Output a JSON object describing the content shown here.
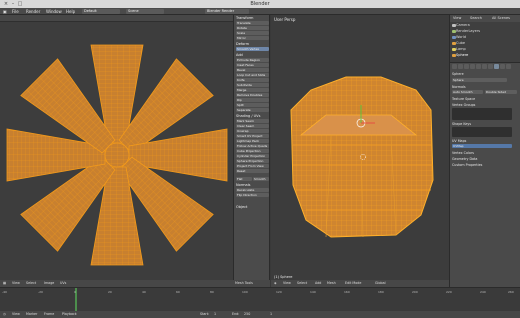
{
  "window": {
    "title": "Blender"
  },
  "menubar": {
    "items": [
      "File",
      "Render",
      "Window",
      "Help"
    ],
    "layout": "Default",
    "scene": "Scene",
    "engine": "Blender Render"
  },
  "uv_editor": {
    "header_items": [
      "View",
      "Select",
      "Image",
      "UVs"
    ],
    "footer_items": [
      "View",
      "Select",
      "Image",
      "UVs"
    ]
  },
  "tool_shelf": {
    "sections": [
      "Transform",
      "Deform",
      "Add",
      "Shading / UVs",
      "Object"
    ],
    "buttons": [
      "Translate",
      "Rotate",
      "Scale",
      "Mirror",
      "Smooth Vertex",
      "Extrude Region",
      "Inset Faces",
      "Bevel",
      "Loop Cut and Slide",
      "Knife",
      "Subdivide",
      "Merge",
      "Remove Doubles",
      "Rip",
      "Split",
      "Separate",
      "Mark Seam",
      "Clear Seam",
      "Unwrap",
      "Smart UV Project",
      "Lightmap Pack",
      "Follow Active Quads",
      "Cube Projection",
      "Cylinder Projection",
      "Sphere Projection",
      "Project From View",
      "Reset",
      "Flat",
      "Smooth",
      "Normals",
      "Recalculate",
      "Flip Direction"
    ],
    "footer": "Mesh Tools"
  },
  "viewport": {
    "label": "User Persp",
    "object": "(1) Sphere",
    "footer_items": [
      "View",
      "Select",
      "Add",
      "Mesh",
      "Edit Mode",
      "Global"
    ]
  },
  "outliner": {
    "tabs": [
      "View",
      "Search",
      "All Scenes"
    ],
    "rows": [
      "Camera",
      "RenderLayers",
      "World",
      "Cube",
      "Lamp",
      "Sphere"
    ]
  },
  "properties": {
    "rows": [
      "Sphere",
      "Sphere",
      "Normals",
      "Auto Smooth",
      "Double Sided",
      "Texture Space",
      "Vertex Groups",
      "Shape Keys",
      "UV Maps",
      "UVMap",
      "Vertex Colors",
      "Geometry Data",
      "Custom Properties"
    ],
    "colors": {
      "panel": "#4a4a4a",
      "accent": "#5578a8"
    }
  },
  "timeline": {
    "ticks": [
      "-40",
      "-20",
      "0",
      "20",
      "40",
      "60",
      "80",
      "100",
      "120",
      "140",
      "160",
      "180",
      "200",
      "220",
      "240",
      "260"
    ],
    "footer_items": [
      "View",
      "Marker",
      "Frame",
      "Playback",
      "Start:",
      "1",
      "End:",
      "250",
      "1"
    ]
  },
  "colors": {
    "mesh_face": "#c8802f",
    "mesh_edge": "#f39a1a",
    "background": "#393939"
  }
}
